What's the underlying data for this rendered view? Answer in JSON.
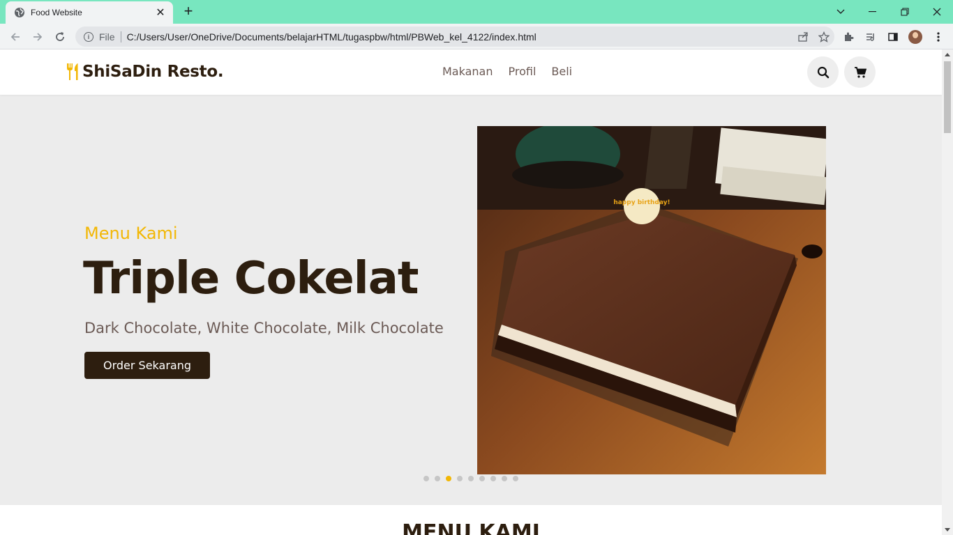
{
  "browser": {
    "tab_title": "Food Website",
    "tab_close": "✕",
    "new_tab": "+",
    "url_scheme": "File",
    "url": "C:/Users/User/OneDrive/Documents/belajarHTML/tugaspbw/html/PBWeb_kel_4122/index.html",
    "minimize": "—",
    "maximize": "❐",
    "close": "✕",
    "tab_search": "⌄"
  },
  "site": {
    "brand": "ShiSaDin Resto.",
    "nav": [
      "Makanan",
      "Profil",
      "Beli"
    ],
    "hero": {
      "subtitle": "Menu Kami",
      "title": "Triple Cokelat",
      "description": "Dark Chocolate, White Chocolate, Milk Chocolate",
      "cta": "Order Sekarang",
      "cake_topper": "happy birthday!"
    },
    "carousel": {
      "count": 9,
      "active_index": 2
    },
    "section_title": "MENU KAMI"
  },
  "colors": {
    "accent": "#f2b705",
    "dark": "#2d1e0f",
    "muted_text": "#6b5a55",
    "hero_bg": "#ececec",
    "tabbar": "#78e6bf"
  }
}
